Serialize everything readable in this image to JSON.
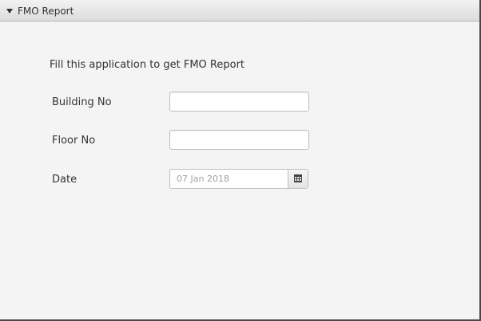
{
  "pane": {
    "title": "FMO Report",
    "collapse_icon": "triangle-down-icon"
  },
  "form": {
    "intro": "Fill this application to get FMO Report",
    "building_label": "Building No",
    "building_value": "",
    "floor_label": "Floor No",
    "floor_value": "",
    "date_label": "Date",
    "date_value": "07 Jan 2018",
    "date_picker_icon": "calendar-icon"
  }
}
